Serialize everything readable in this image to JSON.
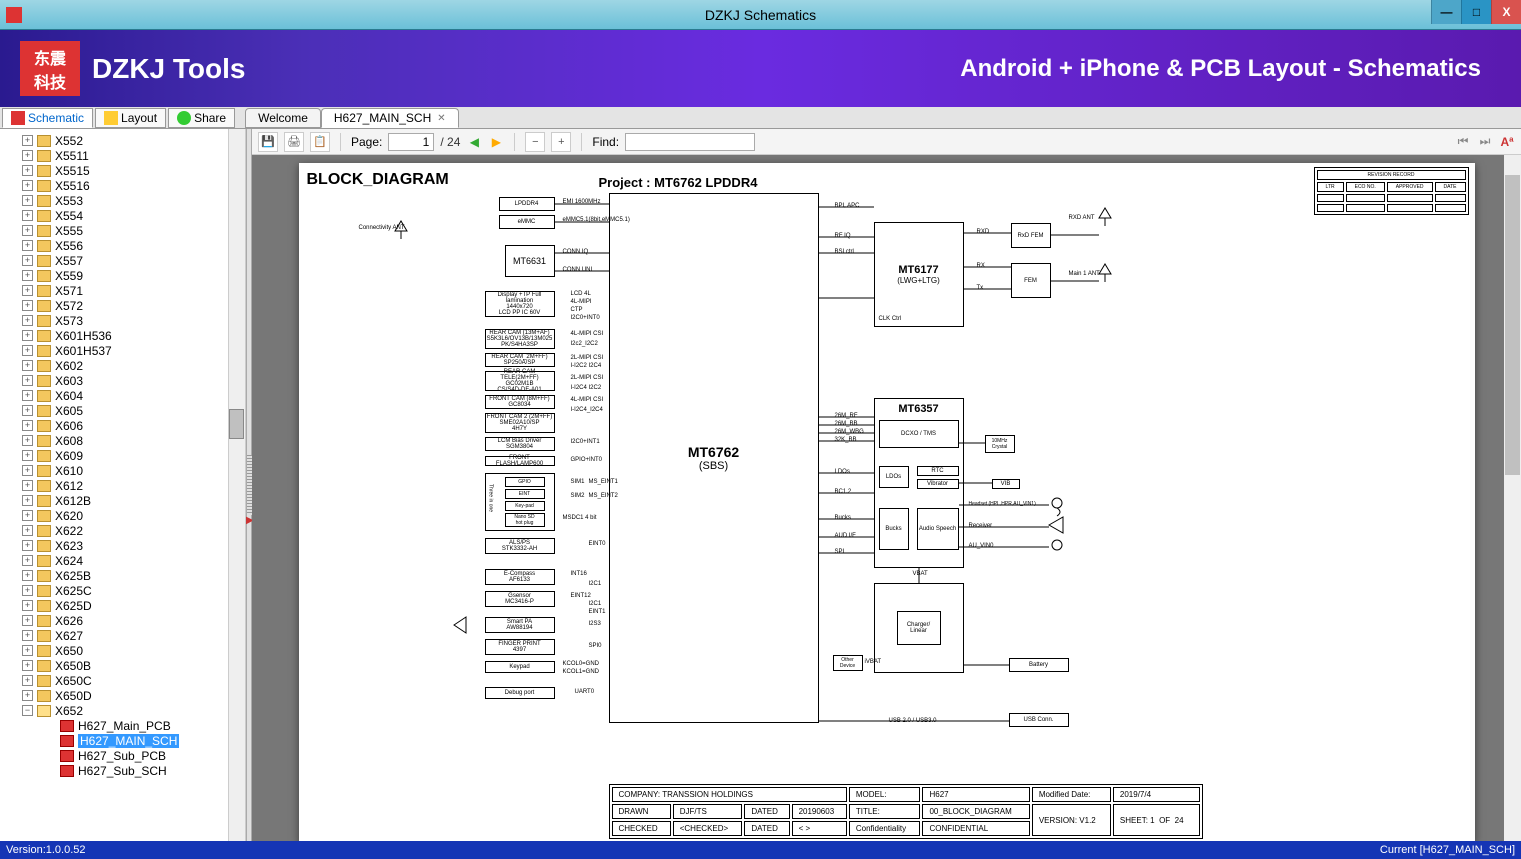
{
  "window": {
    "title": "DZKJ Schematics"
  },
  "banner": {
    "brand": "DZKJ Tools",
    "tagline": "Android + iPhone & PCB Layout - Schematics",
    "logo_top": "东震",
    "logo_bottom": "科技"
  },
  "modes": {
    "schematic": "Schematic",
    "layout": "Layout",
    "share": "Share"
  },
  "tabs": {
    "welcome": "Welcome",
    "active": "H627_MAIN_SCH"
  },
  "toolbar": {
    "page_label": "Page:",
    "page_current": "1",
    "page_total": "/ 24",
    "find_label": "Find:"
  },
  "tree": {
    "folders": [
      "X552",
      "X5511",
      "X5515",
      "X5516",
      "X553",
      "X554",
      "X555",
      "X556",
      "X557",
      "X559",
      "X571",
      "X572",
      "X573",
      "X601H536",
      "X601H537",
      "X602",
      "X603",
      "X604",
      "X605",
      "X606",
      "X608",
      "X609",
      "X610",
      "X612",
      "X612B",
      "X620",
      "X622",
      "X623",
      "X624",
      "X625B",
      "X625C",
      "X625D",
      "X626",
      "X627",
      "X650",
      "X650B",
      "X650C",
      "X650D"
    ],
    "expanded": "X652",
    "children": [
      "H627_Main_PCB",
      "H627_MAIN_SCH",
      "H627_Sub_PCB",
      "H627_Sub_SCH"
    ],
    "selected": "H627_MAIN_SCH"
  },
  "schematic": {
    "heading": "BLOCK_DIAGRAM",
    "project": "Project : MT6762 LPDDR4",
    "main_chip": "MT6762",
    "main_chip_sub": "(SBS)",
    "rf_chip": "MT6177",
    "rf_chip_sub": "(LWG+LTG)",
    "pmic_chip": "MT6357",
    "wifi_chip": "MT6631",
    "left_blocks": {
      "lpddr4": "LPDDR4",
      "emmc": "eMMC",
      "conn_ant": "Connectivity ANT",
      "display": "Display +TP Full lamination",
      "display2": "1440x720",
      "display3": "LCD PP IC 60V",
      "rear_cam": "REAR CAM (13M+AF)",
      "rear_cam2": "S5K3L6/OV13B/13M025",
      "rear_cam3": "PK/S4HA3SP",
      "rear_cam_b": "REAR CAM_2M+FF)",
      "rear_cam_b2": "SP250A/SP",
      "rear_tele": "REAR CAM TELE(2M+FF)",
      "rear_tele2": "GC02M1B",
      "rear_tele3": "CS/S4D-DF-A01",
      "front_cam": "FRONT CAM (8M+FF)",
      "front_cam2": "GC8034",
      "front_cam_b": "FRONT CAM 2 (2M+FF)",
      "front_cam_b2": "SME02A10/SP",
      "front_cam_b3": "4H7Y",
      "lcm_bias": "LCM Bias Driver",
      "lcm_bias2": "SGM3804",
      "flash": "FRONT FLASH/LAMP600",
      "tio_gpio": "GPIO",
      "tio_eint": "EINT",
      "tio_keypad": "Key-pad",
      "tio_sim": "Nano SD",
      "tio_sim2": "hot plug",
      "als": "ALS/PS",
      "als2": "STK3332-AH",
      "ecompass": "E-Compass",
      "ecompass2": "AF6133",
      "gsensor": "Gsensor",
      "gsensor2": "MC3416-P",
      "smartpa": "Smart PA",
      "smartpa2": "AW88194",
      "finger": "FINGER PRINT",
      "finger2": "4397",
      "keypad": "Keypad",
      "debug": "Debug port"
    },
    "left_signals": {
      "emi": "EMI 1600MHz",
      "emmc_if": "eMMC5.1(8bit,eMMC5.1)",
      "conn_iq": "CONN IQ",
      "conn_uni": "CONN UNI",
      "lcd_4l": "LCD 4L",
      "lcd_mipi": "4L-MIPI",
      "ctp": "CTP",
      "i2c0": "I2C0+INT0",
      "mipi_csi": "4L-MIPI CSI",
      "i2c2_2": "I2c2_I2C2",
      "mipi_csi2": "2L-MIPI CSI",
      "i2c2_3": "I-I2C2 I2C4",
      "mipi_csi3": "2L-MIPI CSI",
      "i2c4_2": "I-I2C4 I2C2",
      "mipi_csi4": "4L-MIPI CSI",
      "i2c4_3": "I-I2C4_I2C4",
      "i2c0_int1": "I2C0+INT1",
      "gpio_int0": "GPIO+INT0",
      "sim1": "SIM1",
      "sim2": "SIM2",
      "msdc1": "MSDC1 4 bit",
      "ms_eint1": "MS_EINT1",
      "ms_eint2": "MS_EINT2",
      "eint0": "EINT0",
      "int16": "INT16",
      "i2c1_a": "I2C1",
      "eint12": "EINT12",
      "i2c1_b": "I2C1",
      "eint1": "EINT1",
      "i2s3": "I2S3",
      "spi0": "SPI0",
      "kcol0": "KCOL0=GND",
      "kcol1": "KCOL1=GND",
      "uart0": "UART0"
    },
    "right_signals": {
      "bpi": "BPI, APC",
      "rfiq": "RF IQ",
      "bsi": "BSI ctrl",
      "clk": "CLK Ctrl",
      "m26rf": "26M_RF",
      "m26bb": "26M_BB",
      "m26wbg": "26M_WBG",
      "k32bb": "32K_BB",
      "rxd": "RXD",
      "rx": "RX",
      "tx": "Tx",
      "ldos": "LDOs",
      "bc12": "BC1.2",
      "bucks": "Bucks",
      "aud": "AUD I/F",
      "spi": "SPI",
      "vbat": "VBAT",
      "usb": "USB 2.0 / USB3.0",
      "ivbat": "iVBAT",
      "rxd_ant": "RXD ANT",
      "main_ant": "Main 1 ANT",
      "headset": "Headset (HPL,HPR,AU_VIN1)",
      "receiver": "Receiver",
      "auvin0": "AU_VIN0"
    },
    "pmic_blocks": {
      "dcxo": "DCXO / TMS",
      "ldos": "LDOs",
      "rtc": "RTC",
      "vibrator": "Vibrator",
      "bucks": "Bucks",
      "audio": "Audio Speech",
      "vib": "VIB",
      "charger": "Charger/ Linear",
      "battery": "Battery",
      "usbconn": "USB Conn.",
      "other": "Other Device",
      "rxdfem": "RxD FEM",
      "fem": "FEM",
      "10mhz": "10MHz Crystal"
    },
    "rev_table": {
      "header": "REVISION RECORD",
      "cols": [
        "LTR",
        "ECO NO.",
        "APPROVED",
        "DATE"
      ]
    },
    "info": {
      "company_l": "COMPANY:",
      "company_v": "TRANSSION HOLDINGS",
      "drawn_l": "DRAWN",
      "drawn_v": "DJF/TS",
      "dated_l": "DATED",
      "dated_v": "20190603",
      "checked_l": "CHECKED",
      "checked_v": "<CHECKED>",
      "dated2_l": "DATED",
      "dated2_v": "<  >",
      "model_l": "MODEL:",
      "model_v": "H627",
      "title_l": "TITLE:",
      "title_v": "00_BLOCK_DIAGRAM",
      "conf_l": "Confidentiality",
      "conf_v": "CONFIDENTIAL",
      "mod_l": "Modified Date:",
      "mod_v": "2019/7/4",
      "ver_l": "VERSION:",
      "ver_v": "V1.2",
      "sheet_l": "SHEET:",
      "sheet_v": "1",
      "sheet_of": "OF",
      "sheet_t": "24"
    }
  },
  "status": {
    "version": "Version:1.0.0.52",
    "current": "Current [H627_MAIN_SCH]"
  }
}
